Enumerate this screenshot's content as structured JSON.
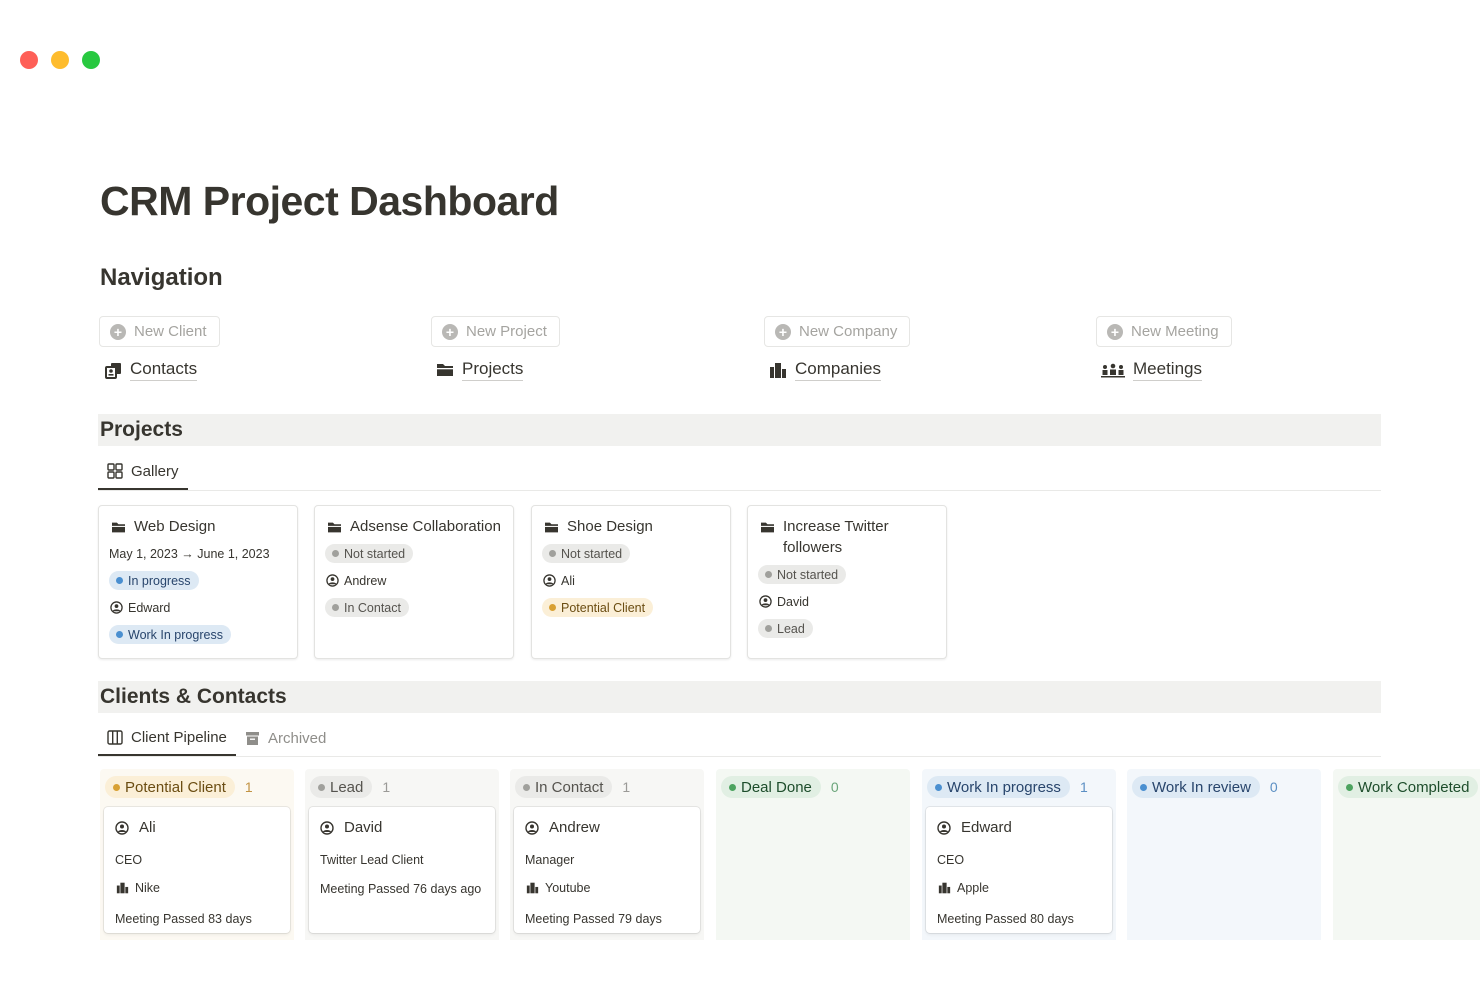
{
  "window": {
    "controls": [
      "close",
      "minimize",
      "zoom"
    ]
  },
  "page": {
    "title": "CRM Project Dashboard"
  },
  "navigation": {
    "heading": "Navigation",
    "items": [
      {
        "new_label": "New Client",
        "link_label": "Contacts",
        "icon": "contacts-icon"
      },
      {
        "new_label": "New Project",
        "link_label": "Projects",
        "icon": "folder-icon"
      },
      {
        "new_label": "New Company",
        "link_label": "Companies",
        "icon": "building-icon"
      },
      {
        "new_label": "New Meeting",
        "link_label": "Meetings",
        "icon": "people-icon"
      }
    ]
  },
  "projects": {
    "heading": "Projects",
    "tabs": [
      {
        "label": "Gallery",
        "icon": "gallery-icon",
        "active": true
      }
    ],
    "cards": [
      {
        "title": "Web Design",
        "date": "May 1, 2023 → June 1, 2023",
        "status": "In progress",
        "person": "Edward",
        "stage": "Work In progress"
      },
      {
        "title": "Adsense Collaboration",
        "status": "Not started",
        "person": "Andrew",
        "stage": "In Contact"
      },
      {
        "title": "Shoe Design",
        "status": "Not started",
        "person": "Ali",
        "stage": "Potential Client"
      },
      {
        "title": "Increase Twitter followers",
        "status": "Not started",
        "person": "David",
        "stage": "Lead"
      }
    ]
  },
  "clients": {
    "heading": "Clients & Contacts",
    "tabs": [
      {
        "label": "Client Pipeline",
        "icon": "board-icon",
        "active": true
      },
      {
        "label": "Archived",
        "icon": "archive-icon",
        "active": false
      }
    ],
    "columns": [
      {
        "label": "Potential Client",
        "count": "1",
        "color": "#d8a033",
        "card": {
          "name": "Ali",
          "role": "CEO",
          "company": "Nike",
          "meeting": "Meeting Passed 83 days"
        }
      },
      {
        "label": "Lead",
        "count": "1",
        "color": "#a0a09c",
        "card": {
          "name": "David",
          "role": "Twitter Lead Client",
          "meeting": "Meeting Passed 76 days ago"
        }
      },
      {
        "label": "In Contact",
        "count": "1",
        "color": "#a0a09c",
        "card": {
          "name": "Andrew",
          "role": "Manager",
          "company": "Youtube",
          "meeting": "Meeting Passed 79 days"
        }
      },
      {
        "label": "Deal Done",
        "count": "0",
        "color": "#4ca35f"
      },
      {
        "label": "Work In progress",
        "count": "1",
        "color": "#4a8fd0",
        "card": {
          "name": "Edward",
          "role": "CEO",
          "company": "Apple",
          "meeting": "Meeting Passed 80 days"
        }
      },
      {
        "label": "Work In review",
        "count": "0",
        "color": "#4a8fd0"
      },
      {
        "label": "Work Completed",
        "count": "",
        "color": "#4ca35f"
      }
    ]
  }
}
